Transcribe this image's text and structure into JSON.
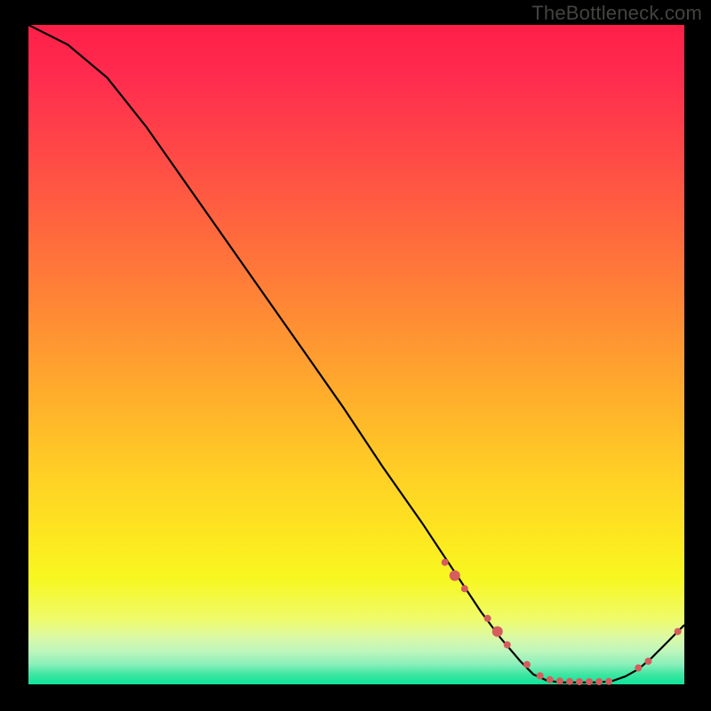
{
  "watermark": "TheBottleneck.com",
  "colors": {
    "background": "#000000",
    "watermark_text": "#44433f",
    "curve_stroke": "#000000",
    "marker_fill": "#d55d5d",
    "gradient_top": "#ff1f48",
    "gradient_bottom": "#0ee39a"
  },
  "chart_data": {
    "type": "line",
    "title": "",
    "xlabel": "",
    "ylabel": "",
    "xlim": [
      0,
      100
    ],
    "ylim": [
      0,
      100
    ],
    "note": "Percent-of-plot coordinates; y=100 top, y=0 bottom. Values estimated from pixels.",
    "curve": [
      {
        "x": 0,
        "y": 100
      },
      {
        "x": 6,
        "y": 97
      },
      {
        "x": 12,
        "y": 92
      },
      {
        "x": 18,
        "y": 84.5
      },
      {
        "x": 24,
        "y": 76
      },
      {
        "x": 30,
        "y": 67.5
      },
      {
        "x": 36,
        "y": 59
      },
      {
        "x": 42,
        "y": 50.5
      },
      {
        "x": 48,
        "y": 42
      },
      {
        "x": 54,
        "y": 33
      },
      {
        "x": 60,
        "y": 24.5
      },
      {
        "x": 63,
        "y": 20
      },
      {
        "x": 66,
        "y": 15.5
      },
      {
        "x": 69,
        "y": 11
      },
      {
        "x": 72,
        "y": 7
      },
      {
        "x": 75,
        "y": 3.5
      },
      {
        "x": 77,
        "y": 1.5
      },
      {
        "x": 79,
        "y": 0.6
      },
      {
        "x": 81,
        "y": 0.3
      },
      {
        "x": 83,
        "y": 0.3
      },
      {
        "x": 85,
        "y": 0.3
      },
      {
        "x": 87,
        "y": 0.3
      },
      {
        "x": 89,
        "y": 0.5
      },
      {
        "x": 91,
        "y": 1.2
      },
      {
        "x": 93,
        "y": 2.3
      },
      {
        "x": 95,
        "y": 4.0
      },
      {
        "x": 97,
        "y": 6.0
      },
      {
        "x": 99,
        "y": 8.0
      },
      {
        "x": 100,
        "y": 9.0
      }
    ],
    "markers": [
      {
        "x": 63.5,
        "y": 18.5,
        "r": 4
      },
      {
        "x": 65.0,
        "y": 16.5,
        "r": 6
      },
      {
        "x": 66.5,
        "y": 14.5,
        "r": 4
      },
      {
        "x": 70.0,
        "y": 10.0,
        "r": 4
      },
      {
        "x": 71.5,
        "y": 8.0,
        "r": 6
      },
      {
        "x": 73.0,
        "y": 6.0,
        "r": 4
      },
      {
        "x": 76.0,
        "y": 3.0,
        "r": 4
      },
      {
        "x": 78.0,
        "y": 1.3,
        "r": 4
      },
      {
        "x": 79.5,
        "y": 0.7,
        "r": 4
      },
      {
        "x": 81.0,
        "y": 0.5,
        "r": 4
      },
      {
        "x": 82.5,
        "y": 0.45,
        "r": 4
      },
      {
        "x": 84.0,
        "y": 0.4,
        "r": 4
      },
      {
        "x": 85.5,
        "y": 0.4,
        "r": 4
      },
      {
        "x": 87.0,
        "y": 0.4,
        "r": 4
      },
      {
        "x": 88.5,
        "y": 0.45,
        "r": 4
      },
      {
        "x": 93.0,
        "y": 2.5,
        "r": 4
      },
      {
        "x": 94.5,
        "y": 3.5,
        "r": 4
      },
      {
        "x": 99.0,
        "y": 8.0,
        "r": 4
      }
    ]
  }
}
